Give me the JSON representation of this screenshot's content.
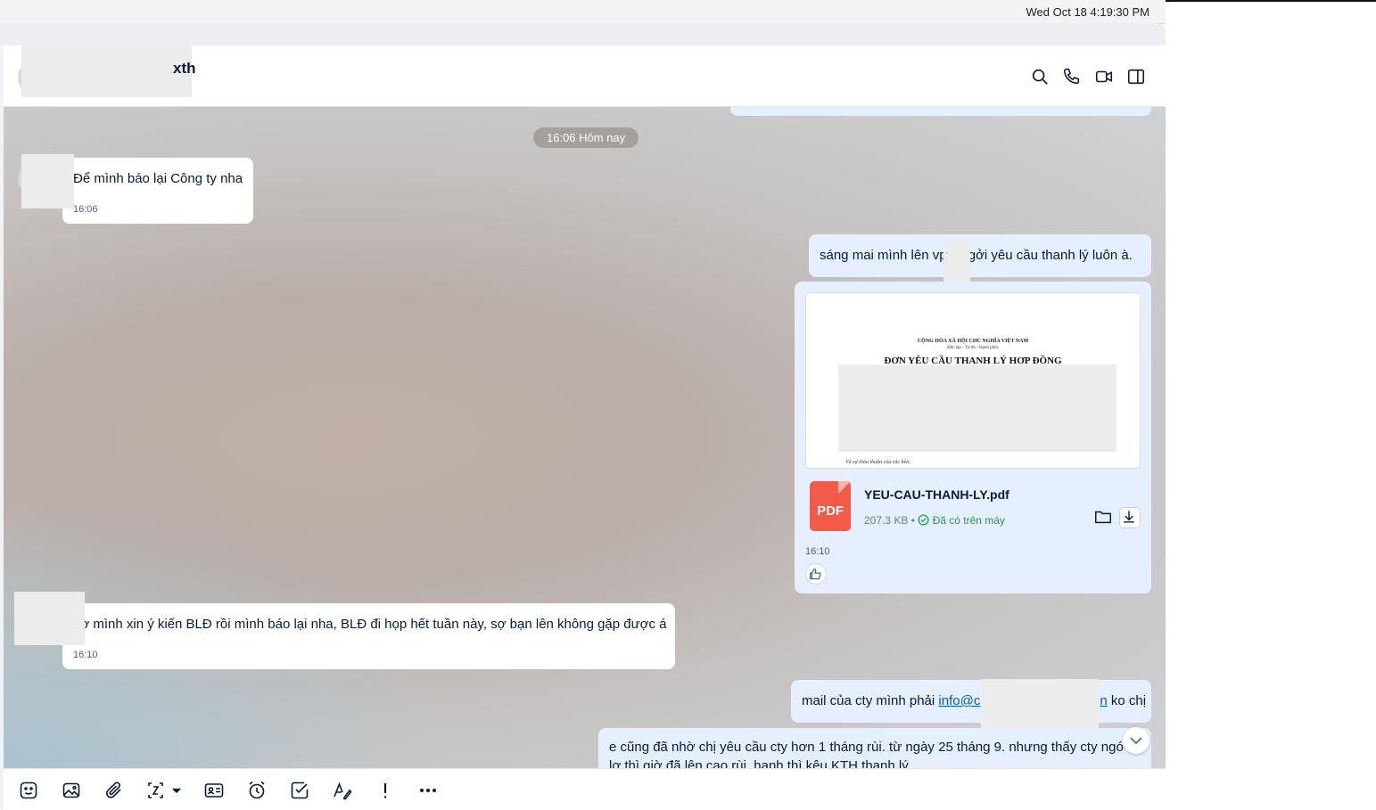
{
  "system": {
    "clock": "Wed Oct 18  4:19:30 PM"
  },
  "header": {
    "contact_name_visible": "xth"
  },
  "date_divider": "16:06 Hôm nay",
  "messages": [
    {
      "text": "Để mình báo lại Công ty nha",
      "time": "16:06"
    },
    {
      "text": "sáng mai mình lên vp    l gởi yêu cầu thanh lý luôn à."
    },
    {
      "file": {
        "preview_line1": "CỘNG HÒA XÃ HỘI CHỦ NGHĨA VIỆT NAM",
        "preview_line2": "Độc lập - Tự do - Hạnh phúc",
        "preview_title": "ĐƠN YÊU CẦU THANH LÝ HỢP ĐỒNG",
        "preview_footer": "Và sự thỏa thuận của các bên;",
        "type_badge": "PDF",
        "name": "YEU-CAU-THANH-LY.pdf",
        "size": "207.3 KB",
        "separator": "•",
        "status": "Đã có trên máy"
      },
      "time": "16:10"
    },
    {
      "text": "hờ mình xin ý kiến BLĐ rồi mình báo lại nha, BLĐ đi họp hết tuần này, sợ bạn lên không gặp được á",
      "time": "16:10"
    },
    {
      "text_before": "mail của cty mình phải ",
      "link": "info@c",
      "link_tail": "n",
      "text_after": " ko chị"
    },
    {
      "text": "e cũng đã nhờ chị yêu cầu cty hơn 1 tháng rùi. từ ngày 25 tháng 9. nhưng thấy cty ngó",
      "text2": "lơ thì giờ đã lên cao rùi, hạnh thì kêu KTH thanh lý"
    }
  ],
  "colors": {
    "incoming_bubble": "#ffffff",
    "outgoing_bubble": "#e5efff",
    "accent": "#005ae0",
    "pdf": "#f25a4a",
    "ok_green": "#1f9a4f"
  }
}
